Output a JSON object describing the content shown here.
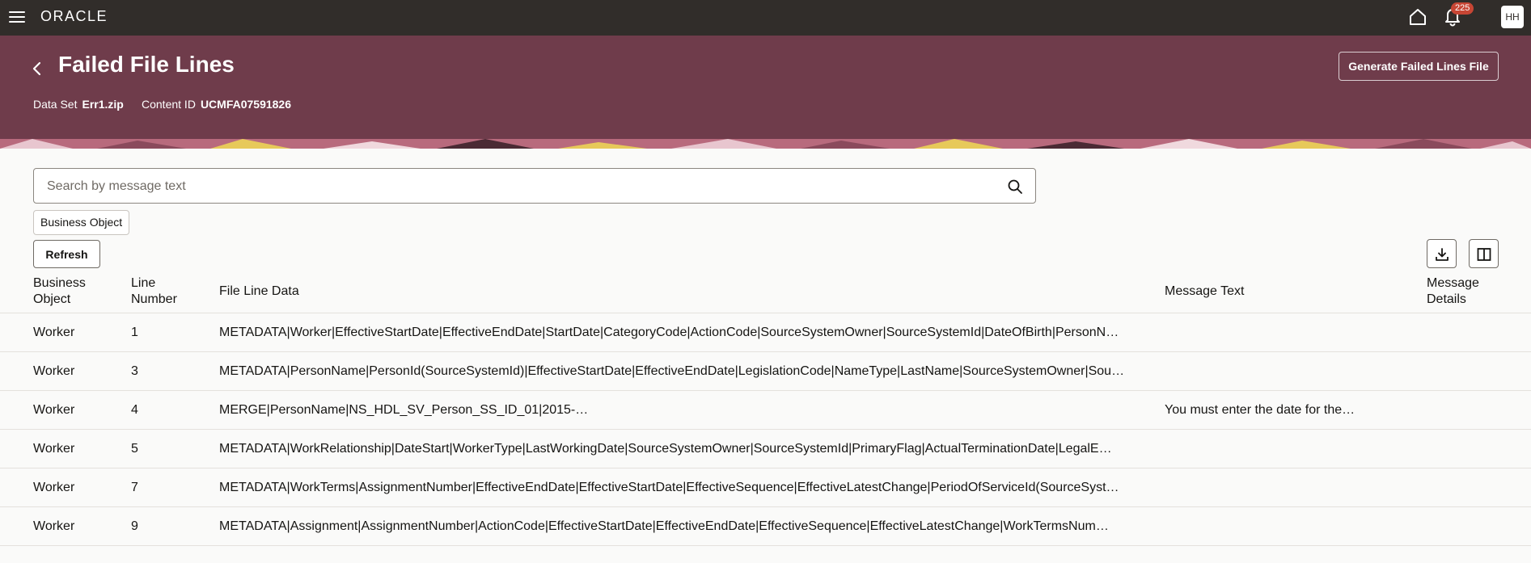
{
  "topbar": {
    "logo": "ORACLE",
    "notification_count": "225",
    "avatar_initials": "HH"
  },
  "header": {
    "title": "Failed File Lines",
    "data_set_label": "Data Set",
    "data_set_value": "Err1.zip",
    "content_id_label": "Content ID",
    "content_id_value": "UCMFA07591826",
    "generate_button": "Generate Failed Lines File"
  },
  "search": {
    "placeholder": "Search by message text"
  },
  "filters": {
    "business_object_chip": "Business Object"
  },
  "toolbar": {
    "refresh_label": "Refresh"
  },
  "table": {
    "columns": [
      {
        "line1": "Business",
        "line2": "Object"
      },
      {
        "line1": "Line",
        "line2": "Number"
      },
      {
        "line1": "File Line Data",
        "line2": ""
      },
      {
        "line1": "Message Text",
        "line2": ""
      },
      {
        "line1": "Message",
        "line2": "Details"
      }
    ],
    "rows": [
      {
        "business_object": "Worker",
        "line_number": "1",
        "file_line_data": "METADATA|Worker|EffectiveStartDate|EffectiveEndDate|StartDate|CategoryCode|ActionCode|SourceSystemOwner|SourceSystemId|DateOfBirth|PersonN…",
        "message_text": ""
      },
      {
        "business_object": "Worker",
        "line_number": "3",
        "file_line_data": "METADATA|PersonName|PersonId(SourceSystemId)|EffectiveStartDate|EffectiveEndDate|LegislationCode|NameType|LastName|SourceSystemOwner|Sou…",
        "message_text": ""
      },
      {
        "business_object": "Worker",
        "line_number": "4",
        "file_line_data": "MERGE|PersonName|NS_HDL_SV_Person_SS_ID_01|2015-…",
        "message_text": "You must enter the date for the…"
      },
      {
        "business_object": "Worker",
        "line_number": "5",
        "file_line_data": "METADATA|WorkRelationship|DateStart|WorkerType|LastWorkingDate|SourceSystemOwner|SourceSystemId|PrimaryFlag|ActualTerminationDate|LegalE…",
        "message_text": ""
      },
      {
        "business_object": "Worker",
        "line_number": "7",
        "file_line_data": "METADATA|WorkTerms|AssignmentNumber|EffectiveEndDate|EffectiveStartDate|EffectiveSequence|EffectiveLatestChange|PeriodOfServiceId(SourceSyst…",
        "message_text": ""
      },
      {
        "business_object": "Worker",
        "line_number": "9",
        "file_line_data": "METADATA|Assignment|AssignmentNumber|ActionCode|EffectiveStartDate|EffectiveEndDate|EffectiveSequence|EffectiveLatestChange|WorkTermsNum…",
        "message_text": ""
      }
    ]
  },
  "colors": {
    "topbar": "#312d2a",
    "header": "#6f3c4b",
    "badge": "#c74634",
    "page_bg": "#fafaf9"
  },
  "icons": {
    "menu": "hamburger-icon",
    "back": "chevron-left-icon",
    "home": "home-icon",
    "notifications": "bell-icon",
    "search": "search-icon",
    "export": "download-icon",
    "columns": "columns-icon"
  }
}
